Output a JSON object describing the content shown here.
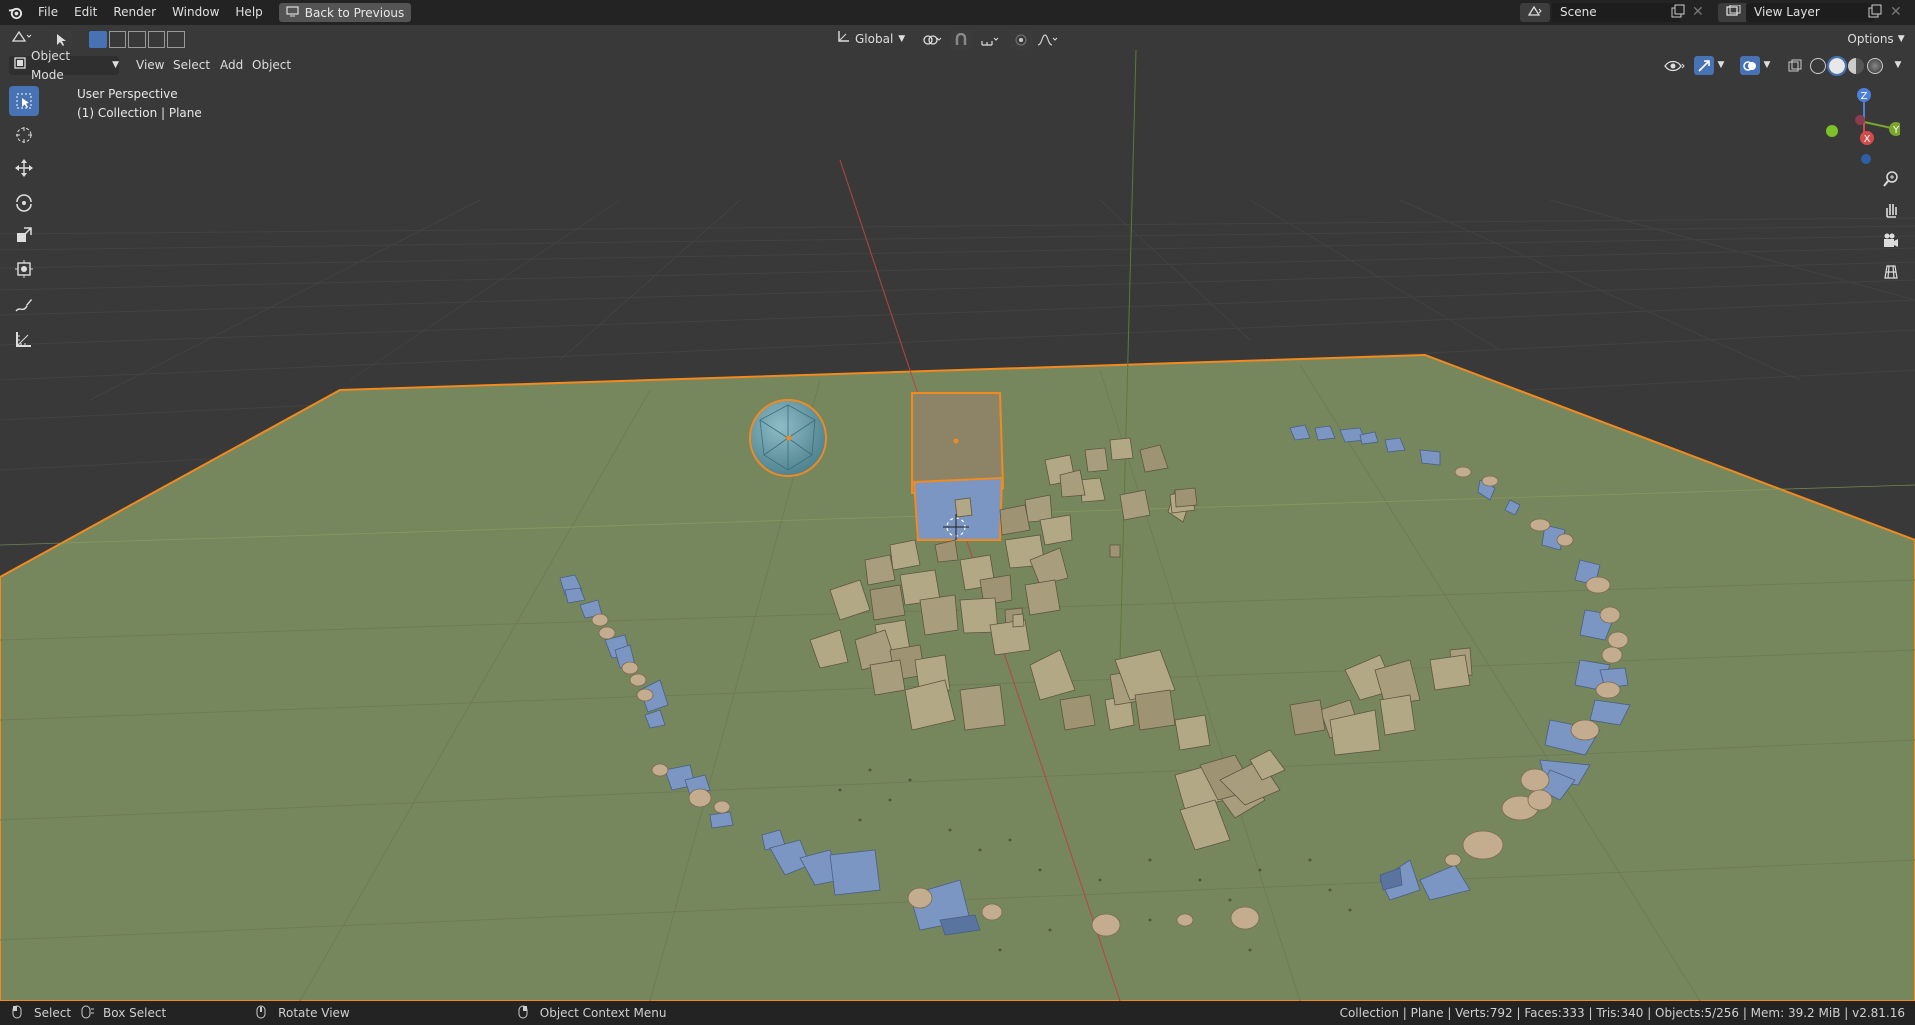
{
  "menu": [
    "File",
    "Edit",
    "Render",
    "Window",
    "Help"
  ],
  "back_button": "Back to Previous",
  "scene": {
    "label": "Scene"
  },
  "view_layer": {
    "label": "View Layer"
  },
  "header": {
    "mode": "Object Mode",
    "menus": [
      "View",
      "Select",
      "Add",
      "Object"
    ],
    "transform_orientation": "Global",
    "options": "Options"
  },
  "viewport": {
    "perspective": "User Perspective",
    "collection": "(1) Collection | Plane"
  },
  "gizmo": {
    "z": "Z",
    "y": "Y",
    "x": "X"
  },
  "status": {
    "select": "Select",
    "box_select": "Box Select",
    "rotate": "Rotate View",
    "context": "Object Context Menu",
    "info": "Collection | Plane | Verts:792 | Faces:333 | Tris:340 | Objects:5/256 | Mem: 39.2 MiB | v2.81.16"
  },
  "colors": {
    "accent": "#4772b3",
    "selection": "#f28a1f",
    "ground": "#77875d",
    "cube": "#b3a886",
    "blue": "#7b96c2"
  }
}
